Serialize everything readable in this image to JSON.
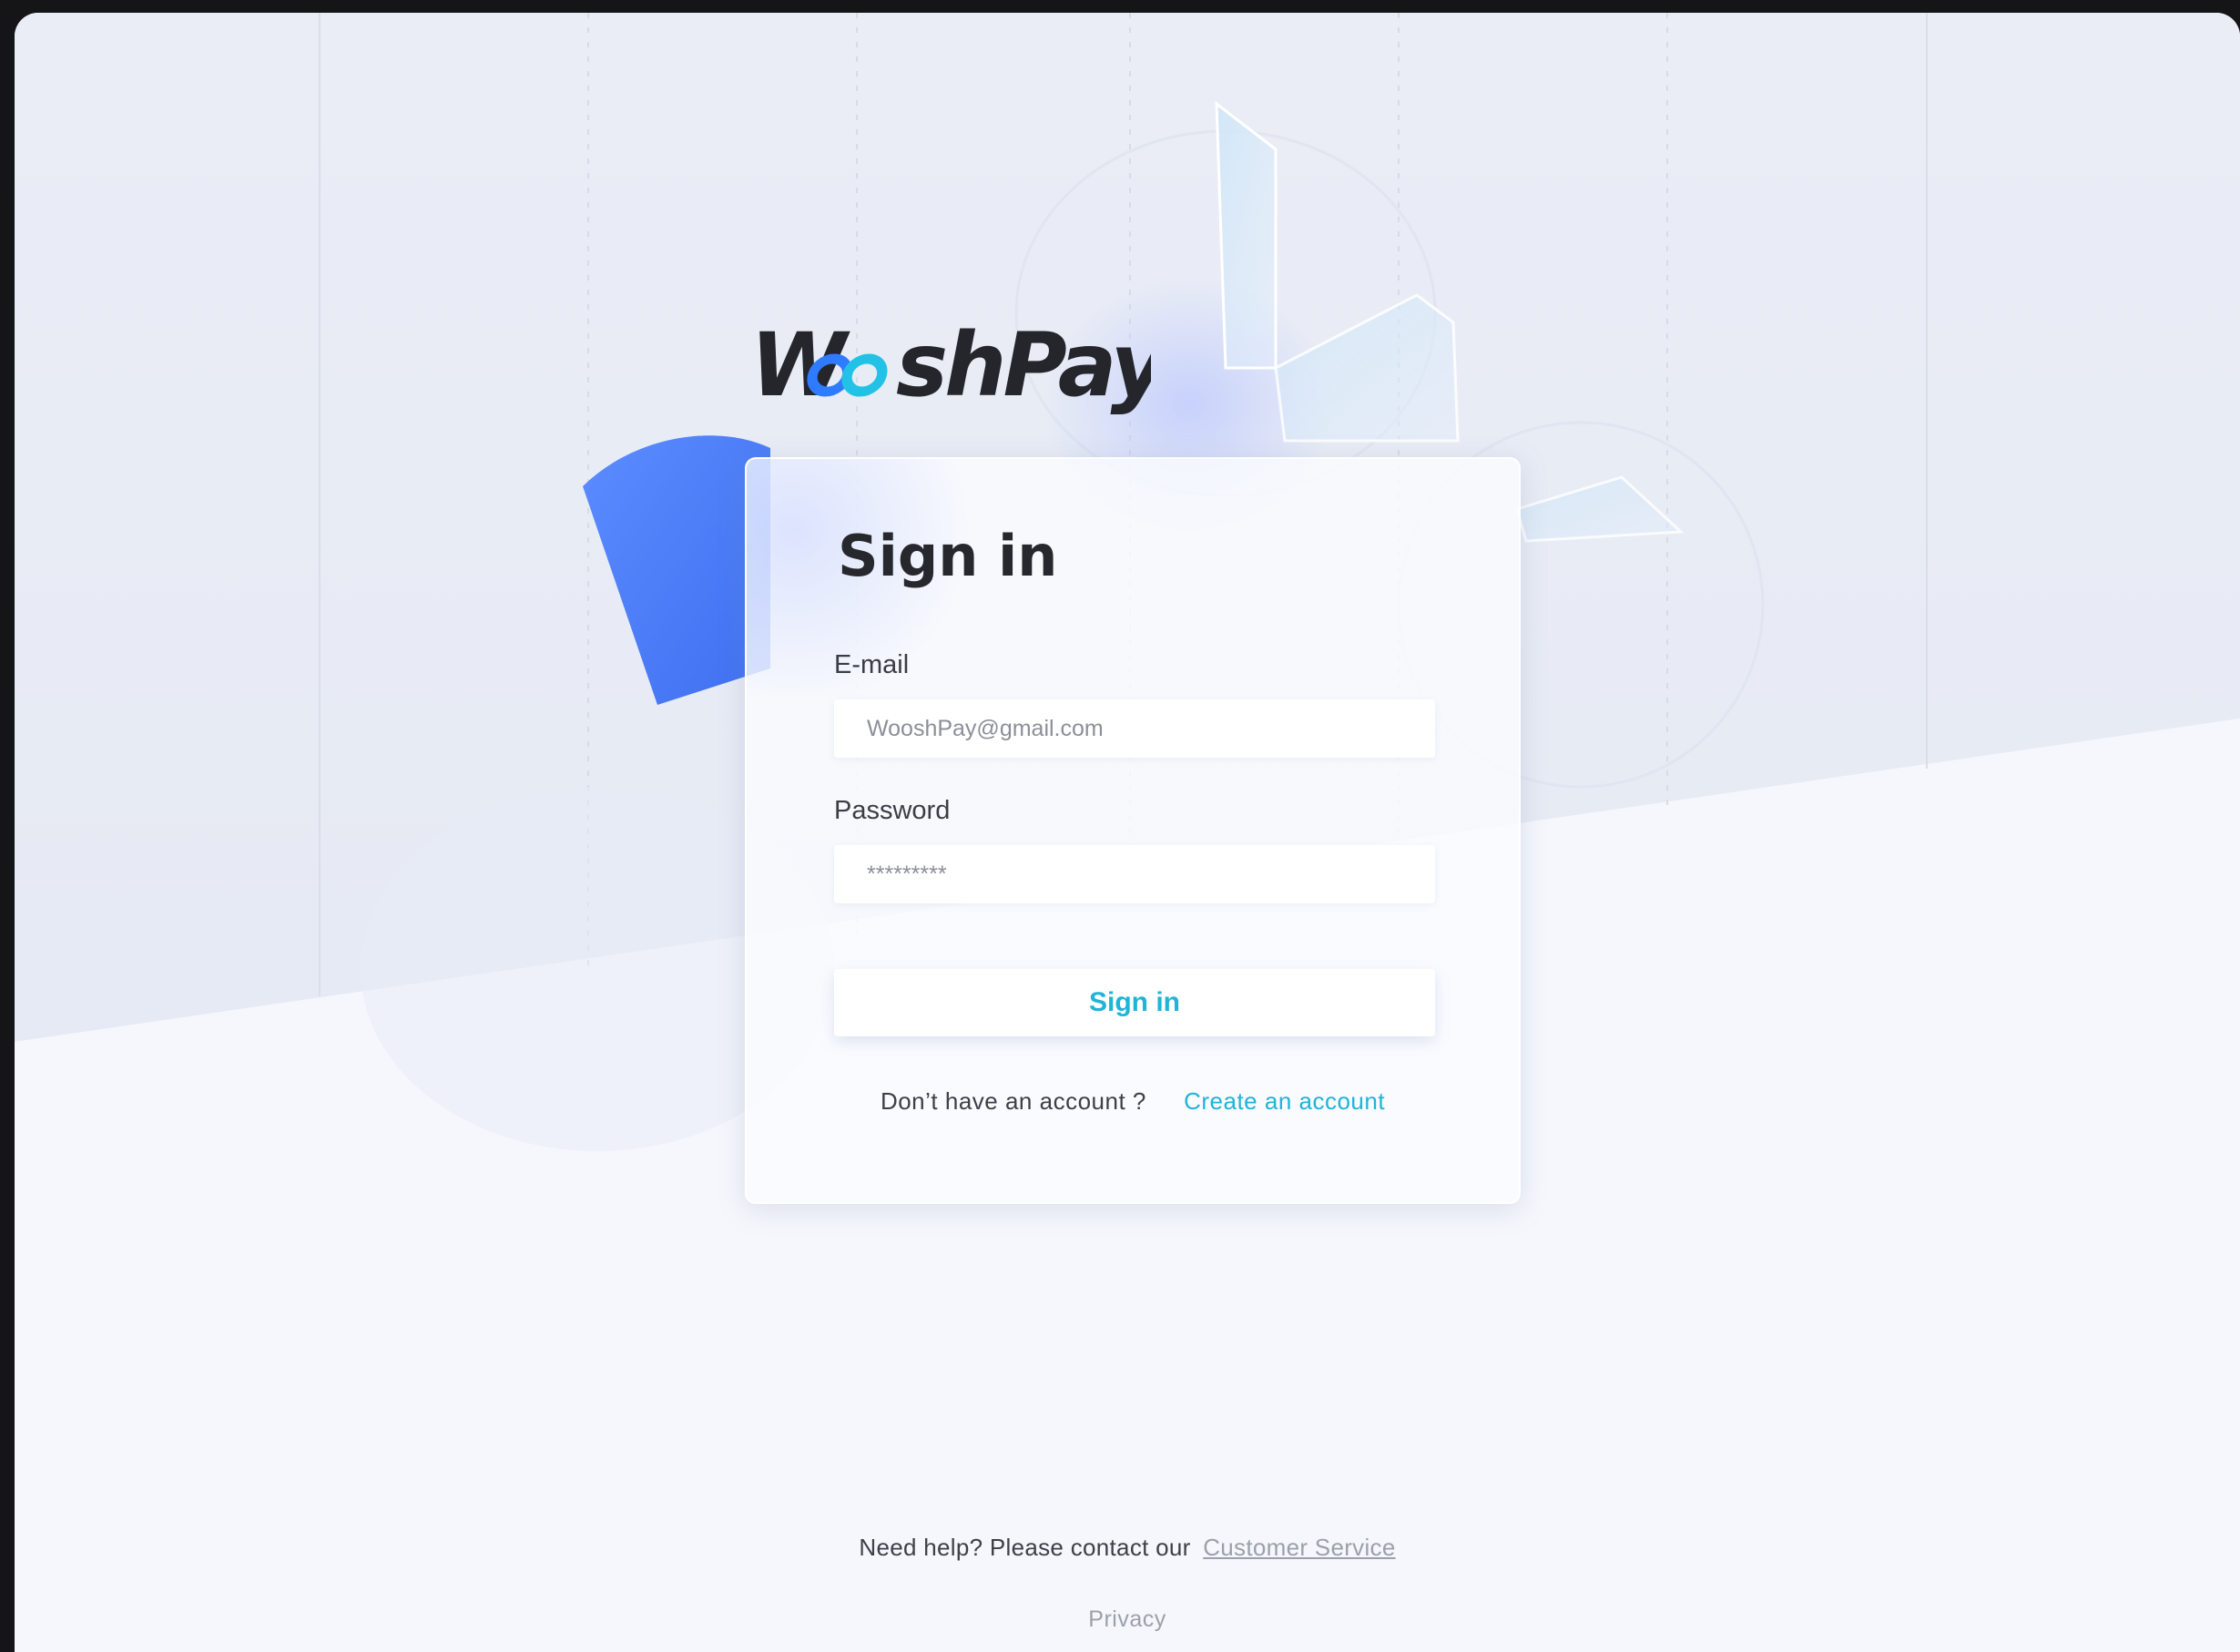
{
  "brand": {
    "name_part1": "W",
    "name_part2": "shPay",
    "colors": {
      "dark": "#25262b",
      "accent_blue": "#2f7bff",
      "accent_cyan": "#22c2e6"
    }
  },
  "signin_card": {
    "title": "Sign in",
    "email": {
      "label": "E-mail",
      "placeholder": "WooshPay@gmail.com"
    },
    "password": {
      "label": "Password",
      "placeholder": "*********"
    },
    "submit_label": "Sign in",
    "no_account_text": "Don’t have an account ?",
    "create_account_label": "Create an account"
  },
  "footer": {
    "help_text": "Need help? Please contact our",
    "customer_service_label": "Customer Service",
    "privacy_label": "Privacy"
  },
  "colors": {
    "link": "#1fb4d8",
    "background": "#f6f8fd",
    "frame": "#151517"
  }
}
